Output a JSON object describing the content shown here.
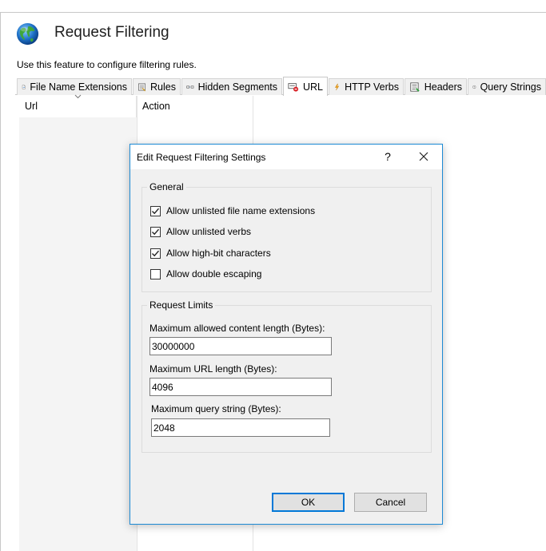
{
  "page": {
    "title": "Request Filtering",
    "description": "Use this feature to configure filtering rules."
  },
  "tabs": [
    {
      "label": "File Name Extensions",
      "icon": "file-extension-icon",
      "active": false
    },
    {
      "label": "Rules",
      "icon": "rules-icon",
      "active": false
    },
    {
      "label": "Hidden Segments",
      "icon": "hidden-segments-icon",
      "active": false
    },
    {
      "label": "URL",
      "icon": "url-deny-icon",
      "active": true
    },
    {
      "label": "HTTP Verbs",
      "icon": "lightning-icon",
      "active": false
    },
    {
      "label": "Headers",
      "icon": "headers-icon",
      "active": false
    },
    {
      "label": "Query Strings",
      "icon": "help-circle-icon",
      "active": false
    }
  ],
  "grid": {
    "columns": [
      "Url",
      "Action"
    ]
  },
  "dialog": {
    "title": "Edit Request Filtering Settings",
    "help_label": "?",
    "general": {
      "legend": "General",
      "options": [
        {
          "label": "Allow unlisted file name extensions",
          "checked": true
        },
        {
          "label": "Allow unlisted verbs",
          "checked": true
        },
        {
          "label": "Allow high-bit characters",
          "checked": true
        },
        {
          "label": "Allow double escaping",
          "checked": false
        }
      ]
    },
    "limits": {
      "legend": "Request Limits",
      "max_content_length_label": "Maximum allowed content length (Bytes):",
      "max_content_length_value": "30000000",
      "max_url_length_label": "Maximum URL length (Bytes):",
      "max_url_length_value": "4096",
      "max_query_string_label": "Maximum query string (Bytes):",
      "max_query_string_value": "2048"
    },
    "ok_label": "OK",
    "cancel_label": "Cancel"
  },
  "colors": {
    "accent": "#0078d7",
    "dialog_border": "#1c8ad4",
    "dialog_bg": "#f0f0f0"
  }
}
